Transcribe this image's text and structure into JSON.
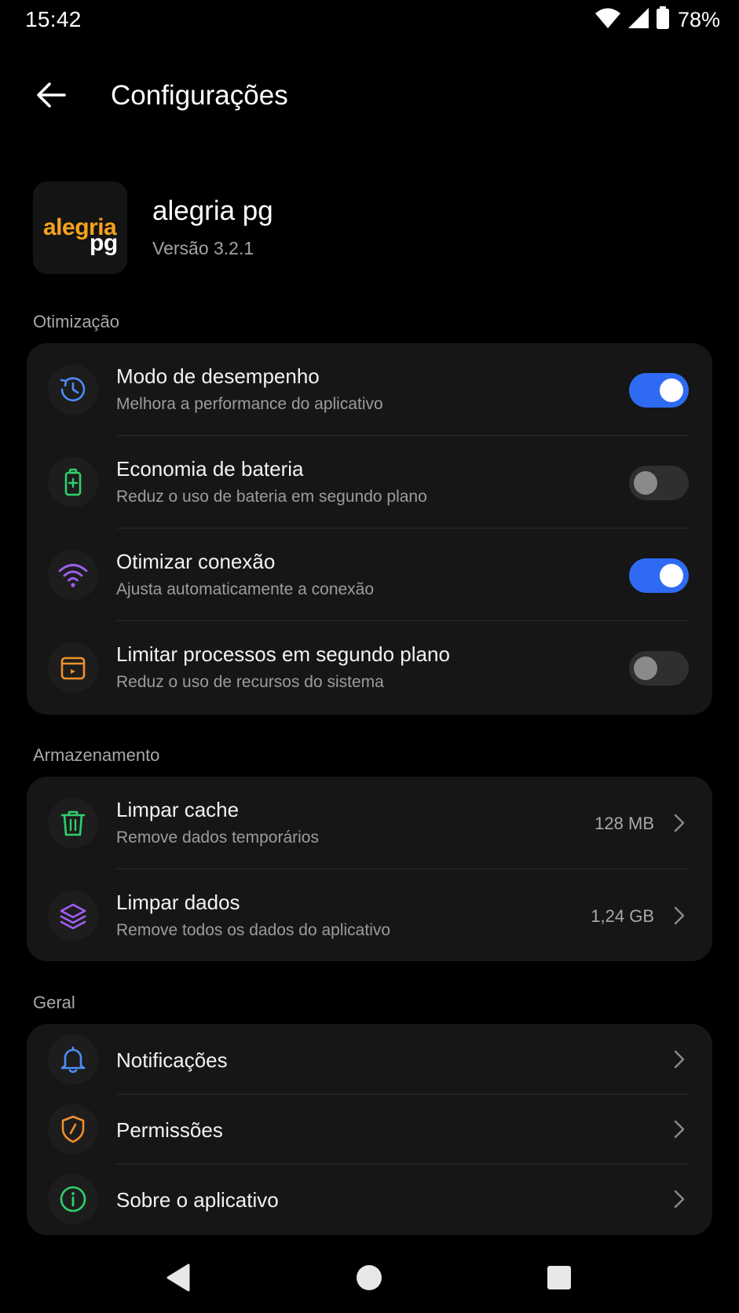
{
  "status_bar": {
    "time": "15:42",
    "battery_percent": "78%",
    "icons": [
      "wifi-icon",
      "signal-icon",
      "battery-icon"
    ]
  },
  "header": {
    "title": "Configurações",
    "back_icon": "arrow-left-icon"
  },
  "app": {
    "logo_text_top": "alegria",
    "logo_text_bottom": "pg",
    "name": "alegria pg",
    "version": "Versão 3.2.1"
  },
  "sections": {
    "optimization": {
      "title": "Otimização",
      "items": [
        {
          "title": "Modo de desempenho",
          "subtitle": "Melhora a performance do aplicativo",
          "icon": "clock-history-icon",
          "icon_color": "#4d8df7",
          "enabled": true
        },
        {
          "title": "Economia de bateria",
          "subtitle": "Reduz o uso de bateria em segundo plano",
          "icon": "battery-plus-icon",
          "icon_color": "#2fcf6d",
          "enabled": false
        },
        {
          "title": "Otimizar conexão",
          "subtitle": "Ajusta automaticamente a conexão",
          "icon": "wifi-icon",
          "icon_color": "#a15ef5",
          "enabled": true
        },
        {
          "title": "Limitar processos em segundo plano",
          "subtitle": "Reduz o uso de recursos do sistema",
          "icon": "process-box-icon",
          "icon_color": "#f0902c",
          "enabled": false
        }
      ]
    },
    "storage": {
      "title": "Armazenamento",
      "items": [
        {
          "title": "Limpar cache",
          "subtitle": "Remove dados temporários",
          "value": "128 MB",
          "icon": "trash-icon",
          "icon_color": "#2fcf6d"
        },
        {
          "title": "Limpar dados",
          "subtitle": "Remove todos os dados do aplicativo",
          "value": "1,24 GB",
          "icon": "layers-icon",
          "icon_color": "#a15ef5"
        }
      ]
    },
    "general": {
      "title": "Geral",
      "items": [
        {
          "title": "Notificações",
          "icon": "bell-icon",
          "icon_color": "#4d8df7"
        },
        {
          "title": "Permissões",
          "icon": "shield-icon",
          "icon_color": "#f0902c"
        },
        {
          "title": "Sobre o aplicativo",
          "icon": "info-icon",
          "icon_color": "#2fcf6d"
        }
      ]
    }
  },
  "colors": {
    "accent": "#2f6bf2",
    "background": "#000000",
    "card": "#161616",
    "logo_orange": "#f7a21b"
  },
  "nav_bar": {
    "icons": [
      "nav-back-icon",
      "nav-home-icon",
      "nav-recents-icon"
    ]
  }
}
